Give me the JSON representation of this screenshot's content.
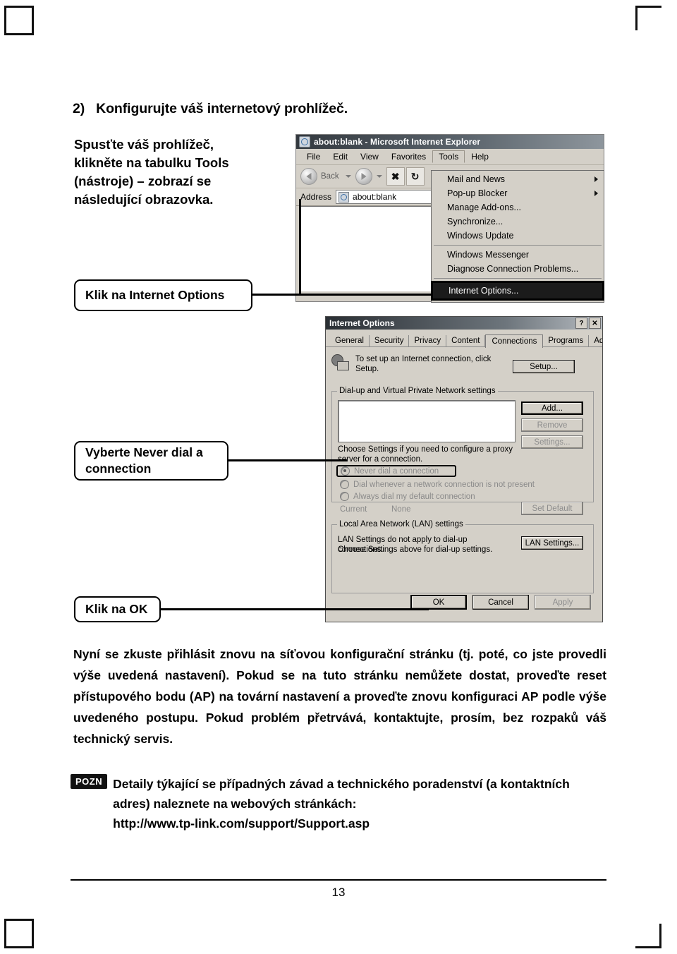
{
  "page": {
    "step_number": "2)",
    "step_title": "Konfigurujte váš internetový prohlížeč.",
    "intro_line1": "Spusťte váš prohlížeč,",
    "intro_line2_pre": "klikněte na tabulku ",
    "intro_line2_bold": "Tools",
    "intro_line3": "(nástroje) – zobrazí se",
    "intro_line4": "následující obrazovka.",
    "closing_paragraph": "Nyní se zkuste přihlásit znovu na síťovou konfigurační stránku (tj. poté, co jste provedli výše uvedená nastavení). Pokud se na tuto stránku nemůžete dostat, proveďte reset přístupového bodu (AP) na tovární nastavení a proveďte znovu konfiguraci AP podle výše uvedeného postupu. Pokud problém přetrvává, kontaktujte, prosím, bez rozpaků váš technický servis.",
    "page_number": "13"
  },
  "callouts": {
    "internet_options": {
      "prefix": "Klik na ",
      "bold": "Internet Options"
    },
    "never_dial": {
      "prefix": "Vyberte ",
      "bold": "Never dial a connection"
    },
    "ok": {
      "prefix": "Klik na ",
      "bold": "OK"
    }
  },
  "note": {
    "badge": "POZN",
    "text": "Detaily týkající se případných závad a technického poradenství (a kontaktních adres) naleznete na webových stránkách:",
    "url": "http://www.tp-link.com/support/Support.asp"
  },
  "browser": {
    "title": "about:blank - Microsoft Internet Explorer",
    "menus": [
      "File",
      "Edit",
      "View",
      "Favorites",
      "Tools",
      "Help"
    ],
    "active_menu": "Tools",
    "toolbar": {
      "back_label": "Back",
      "stop_glyph": "✖"
    },
    "address_label": "Address",
    "address_value": "about:blank"
  },
  "tools_menu": {
    "items": [
      {
        "label": "Mail and News",
        "submenu": true
      },
      {
        "label": "Pop-up Blocker",
        "submenu": true
      },
      {
        "label": "Manage Add-ons...",
        "submenu": false
      },
      {
        "label": "Synchronize...",
        "submenu": false
      },
      {
        "label": "Windows Update",
        "submenu": false
      }
    ],
    "items2": [
      {
        "label": "Windows Messenger",
        "submenu": false
      },
      {
        "label": "Diagnose Connection Problems...",
        "submenu": false
      }
    ],
    "highlighted": "Internet Options..."
  },
  "dialog": {
    "title": "Internet Options",
    "help_btn": "?",
    "close_btn": "✕",
    "tabs": [
      "General",
      "Security",
      "Privacy",
      "Content",
      "Connections",
      "Programs",
      "Advanced"
    ],
    "selected_tab": "Connections",
    "setup_text": "To set up an Internet connection, click Setup.",
    "setup_button": "Setup...",
    "dialup_group_label": "Dial-up and Virtual Private Network settings",
    "add_button": "Add...",
    "remove_button": "Remove",
    "settings_button": "Settings...",
    "proxy_text": "Choose Settings if you need to configure a proxy server for a connection.",
    "radio_never": "Never dial a connection",
    "radio_whenever": "Dial whenever a network connection is not present",
    "radio_always": "Always dial my default connection",
    "current_label": "Current",
    "current_value": "None",
    "set_default_button": "Set Default",
    "lan_group_label": "Local Area Network (LAN) settings",
    "lan_text_line1": "LAN Settings do not apply to dial-up connections.",
    "lan_text_line2": "Choose Settings above for dial-up settings.",
    "lan_settings_button": "LAN Settings...",
    "ok_button": "OK",
    "cancel_button": "Cancel",
    "apply_button": "Apply"
  }
}
